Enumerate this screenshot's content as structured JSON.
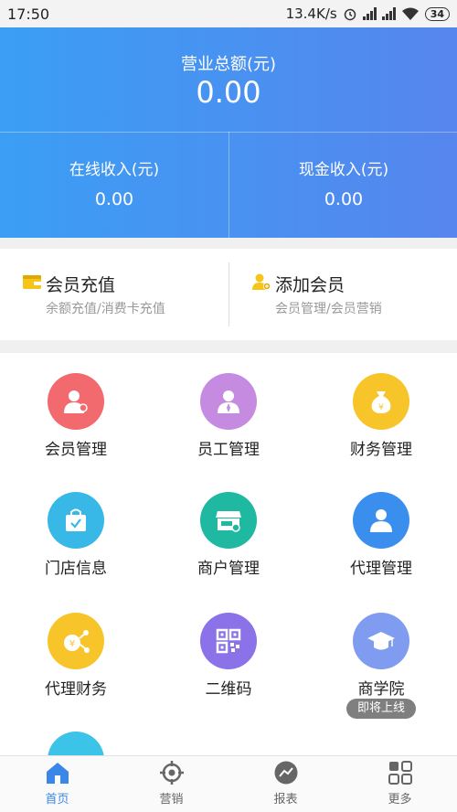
{
  "status_bar": {
    "time": "17:50",
    "net_speed": "13.4K/s",
    "battery": "34"
  },
  "header": {
    "total_label": "营业总额(元)",
    "total_value": "0.00",
    "online_label": "在线收入(元)",
    "online_value": "0.00",
    "cash_label": "现金收入(元)",
    "cash_value": "0.00"
  },
  "quick_actions": [
    {
      "title": "会员充值",
      "subtitle": "余额充值/消费卡充值",
      "icon": "wallet-icon",
      "color": "#f5c518"
    },
    {
      "title": "添加会员",
      "subtitle": "会员管理/会员营销",
      "icon": "add-user-icon",
      "color": "#f5c518"
    }
  ],
  "menu": [
    {
      "label": "会员管理",
      "icon": "member-icon",
      "color": "#f26a6e"
    },
    {
      "label": "员工管理",
      "icon": "staff-icon",
      "color": "#c58be0"
    },
    {
      "label": "财务管理",
      "icon": "money-bag-icon",
      "color": "#f7c52a"
    },
    {
      "label": "门店信息",
      "icon": "store-bag-icon",
      "color": "#37b8e6"
    },
    {
      "label": "商户管理",
      "icon": "merchant-icon",
      "color": "#1fb8a0"
    },
    {
      "label": "代理管理",
      "icon": "agent-icon",
      "color": "#3a8eed"
    },
    {
      "label": "代理财务",
      "icon": "agent-finance-icon",
      "color": "#f7c52a"
    },
    {
      "label": "二维码",
      "icon": "qrcode-icon",
      "color": "#8b72e8"
    },
    {
      "label": "商学院",
      "icon": "graduation-cap-icon",
      "color": "#7f9cf0",
      "badge": "即将上线"
    }
  ],
  "nav": [
    {
      "label": "首页",
      "icon": "home-icon",
      "active": true
    },
    {
      "label": "营销",
      "icon": "target-icon",
      "active": false
    },
    {
      "label": "报表",
      "icon": "chart-icon",
      "active": false
    },
    {
      "label": "更多",
      "icon": "grid-icon",
      "active": false
    }
  ]
}
